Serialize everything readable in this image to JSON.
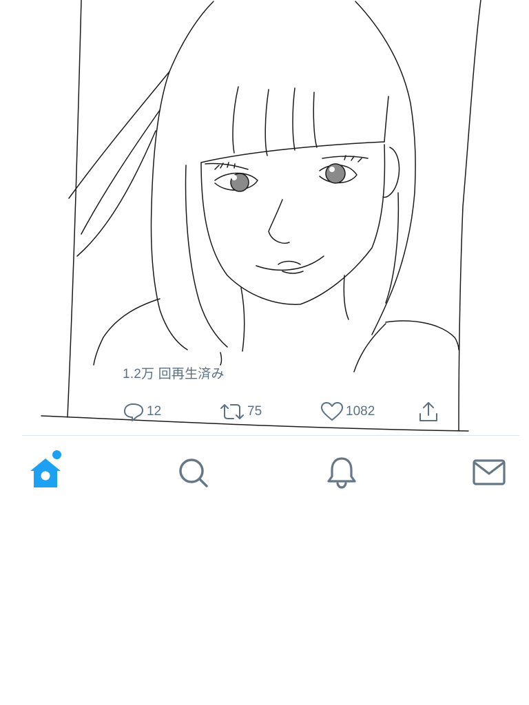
{
  "tweet": {
    "view_count": "1.2万 回再生済み",
    "actions": {
      "reply": {
        "icon": "reply-icon",
        "count": "12"
      },
      "retweet": {
        "icon": "retweet-icon",
        "count": "75"
      },
      "like": {
        "icon": "heart-icon",
        "count": "1082"
      },
      "share": {
        "icon": "share-icon"
      }
    }
  },
  "tabbar": {
    "active_tab": "home",
    "tabs": [
      {
        "id": "home",
        "icon": "home-icon",
        "has_badge": true
      },
      {
        "id": "search",
        "icon": "search-icon"
      },
      {
        "id": "notifications",
        "icon": "bell-icon"
      },
      {
        "id": "messages",
        "icon": "envelope-icon"
      }
    ]
  },
  "colors": {
    "accent": "#1da1f2",
    "icon_gray": "#5b7083",
    "nav_gray": "#657786",
    "divider": "#e1e8ed"
  }
}
